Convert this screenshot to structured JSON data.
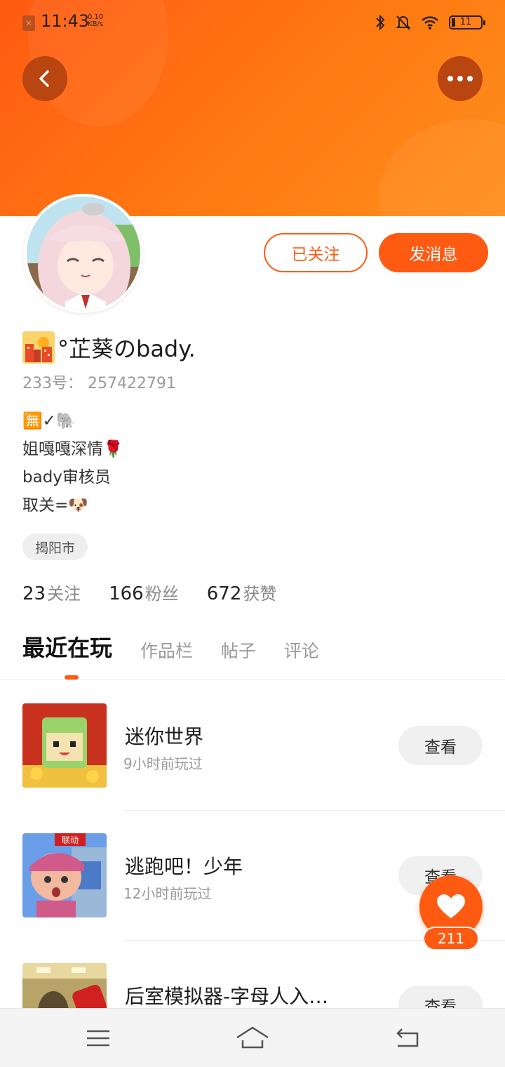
{
  "status_bar": {
    "time": "11:43",
    "speed_value": "0.10",
    "speed_unit": "KB/s",
    "battery": "11"
  },
  "profile": {
    "name": "°芷葵のbady.",
    "uid_label": "233号：",
    "uid": "257422791",
    "bio_lines": [
      "🈚✓🐘",
      "姐嘎嘎深情🌹",
      "bady审核员",
      "取关=🐶"
    ],
    "location": "揭阳市",
    "follow_button": "已关注",
    "message_button": "发消息"
  },
  "stats": [
    {
      "value": "23",
      "label": "关注"
    },
    {
      "value": "166",
      "label": "粉丝"
    },
    {
      "value": "672",
      "label": "获赞"
    }
  ],
  "tabs": [
    {
      "label": "最近在玩",
      "active": true
    },
    {
      "label": "作品栏",
      "active": false
    },
    {
      "label": "帖子",
      "active": false
    },
    {
      "label": "评论",
      "active": false
    }
  ],
  "games": [
    {
      "name": "迷你世界",
      "time": "9小时前玩过",
      "button": "查看"
    },
    {
      "name": "逃跑吧！少年",
      "time": "12小时前玩过",
      "button": "查看",
      "badge": "联动"
    },
    {
      "name": "后室模拟器-字母人入…",
      "time": "",
      "button": "查看"
    }
  ],
  "like": {
    "count": "211"
  },
  "icons": {
    "back": "chevron-left-icon",
    "more": "more-dots-icon",
    "heart": "heart-icon",
    "nav_menu": "menu-icon",
    "nav_home": "home-icon",
    "nav_back": "return-icon"
  },
  "colors": {
    "accent": "#ff5a12"
  }
}
